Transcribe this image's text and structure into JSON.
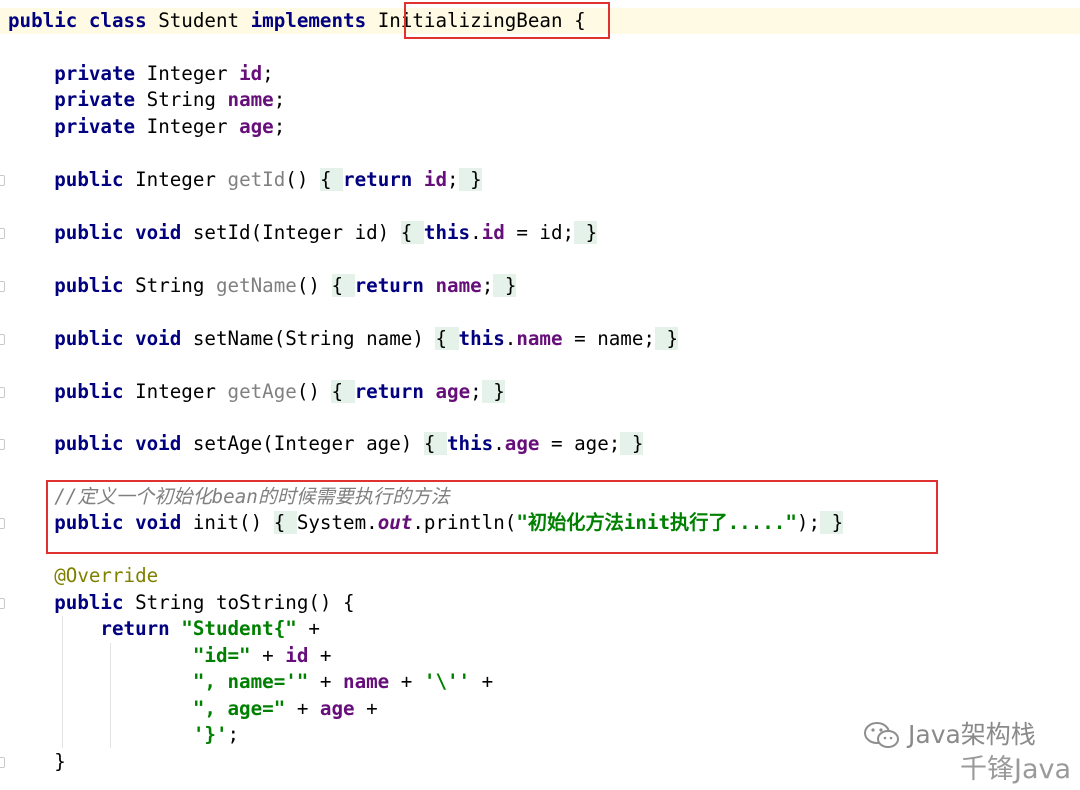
{
  "editor": {
    "language": "Java",
    "class_name": "Student",
    "lines": [
      "public class Student implements InitializingBean {",
      "",
      "    private Integer id;",
      "    private String name;",
      "    private Integer age;",
      "",
      "    public Integer getId() { return id; }",
      "",
      "    public void setId(Integer id) { this.id = id; }",
      "",
      "    public String getName() { return name; }",
      "",
      "    public void setName(String name) { this.name = name; }",
      "",
      "    public Integer getAge() { return age; }",
      "",
      "    public void setAge(Integer age) { this.age = age; }",
      "",
      "    //定义一个初始化bean的时候需要执行的方法",
      "    public void init() { System.out.println(\"初始化方法init执行了.....\"); }",
      "",
      "    @Override",
      "    public String toString() {",
      "        return \"Student{\" +",
      "                \"id=\" + id +",
      "                \", name='\" + name + '\\'' +",
      "                \", age=\" + age +",
      "                '}';",
      "    }"
    ]
  },
  "highlights": {
    "interface_box_text": "InitializingBean",
    "init_box_comment": "//定义一个初始化bean的时候需要执行的方法",
    "box_color": "#e03131"
  },
  "syntax_colors": {
    "keyword": "#000080",
    "field": "#660e7a",
    "string": "#008000",
    "comment": "#808080",
    "annotation": "#808000",
    "caret_line": "#fffae3",
    "folded_region": "#e4f2e9"
  },
  "watermark": {
    "line1": "Java架构栈",
    "line2": "千锋Java",
    "icon": "wechat-icon"
  }
}
